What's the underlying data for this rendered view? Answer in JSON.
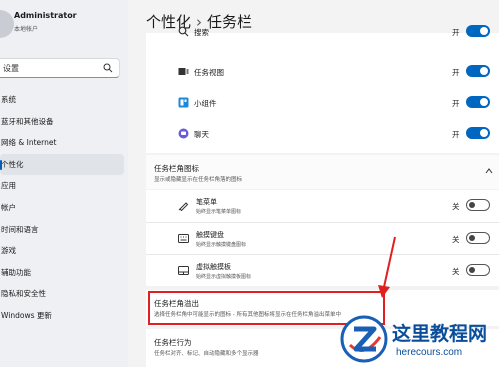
{
  "user": {
    "name": "Administrator",
    "account_type": "本地帐户"
  },
  "search": {
    "value": "设置"
  },
  "nav": {
    "items": [
      {
        "label": "系统"
      },
      {
        "label": "蓝牙和其他设备"
      },
      {
        "label": "网络 & Internet"
      },
      {
        "label": "个性化",
        "active": true
      },
      {
        "label": "应用"
      },
      {
        "label": "帐户"
      },
      {
        "label": "时间和语言"
      },
      {
        "label": "游戏"
      },
      {
        "label": "辅助功能"
      },
      {
        "label": "隐私和安全性"
      },
      {
        "label": "Windows 更新"
      }
    ]
  },
  "header": {
    "crumb_parent": "个性化",
    "separator": "›",
    "crumb_current": "任务栏"
  },
  "taskbar_items": [
    {
      "label": "搜索",
      "icon": "search-icon",
      "state": "开",
      "on": true
    },
    {
      "label": "任务视图",
      "icon": "task-view-icon",
      "state": "开",
      "on": true
    },
    {
      "label": "小组件",
      "icon": "widgets-icon",
      "state": "开",
      "on": true
    },
    {
      "label": "聊天",
      "icon": "chat-icon",
      "state": "开",
      "on": true
    }
  ],
  "corner_icons": {
    "title": "任务栏角图标",
    "description": "显示或隐藏显示在任务栏角落的图标",
    "items": [
      {
        "title": "笔菜单",
        "description": "始终显示笔菜单图标",
        "icon": "pen-icon",
        "state": "关",
        "on": false
      },
      {
        "title": "触摸键盘",
        "description": "始终显示触摸键盘图标",
        "icon": "keyboard-icon",
        "state": "关",
        "on": false
      },
      {
        "title": "虚拟触摸板",
        "description": "始终显示虚拟触摸板图标",
        "icon": "touchpad-icon",
        "state": "关",
        "on": false
      }
    ]
  },
  "corner_overflow": {
    "title": "任务栏角溢出",
    "description": "选择任务栏角中可能显示的图标 - 所有其他图标将显示在任务栏角溢出菜单中"
  },
  "behaviors": {
    "title": "任务栏行为",
    "description": "任务栏对齐、标记、自动隐藏和多个显示器"
  },
  "colors": {
    "accent": "#0067c0",
    "highlight_box": "#e02020"
  },
  "watermark": {
    "title": "这里教程网",
    "url": "herecours.com"
  }
}
